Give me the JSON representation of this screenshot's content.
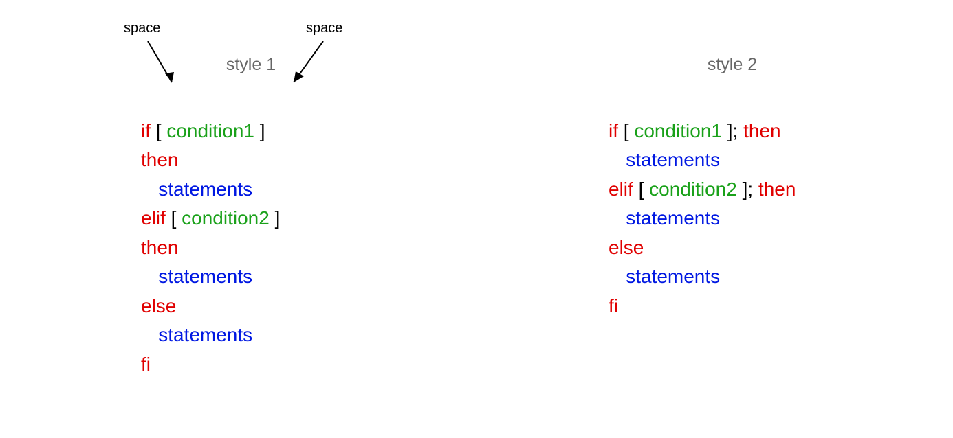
{
  "annotations": {
    "left_label": "space",
    "right_label": "space"
  },
  "style1": {
    "title": "style 1",
    "lines": {
      "l1_if": "if",
      "l1_ob": "[",
      "l1_cond": "condition1",
      "l1_cb": "]",
      "l2_then": "then",
      "l3_stm": "statements",
      "l4_elif": "elif",
      "l4_ob": "[",
      "l4_cond": "condition2",
      "l4_cb": "]",
      "l5_then": "then",
      "l6_stm": "statements",
      "l7_else": "else",
      "l8_stm": "statements",
      "l9_fi": "fi"
    }
  },
  "style2": {
    "title": "style 2",
    "lines": {
      "l1_if": "if",
      "l1_ob": "[",
      "l1_cond": "condition1",
      "l1_cb": "];",
      "l1_then": "then",
      "l2_stm": "statements",
      "l3_elif": "elif",
      "l3_ob": "[",
      "l3_cond": "condition2",
      "l3_cb": "];",
      "l3_then": "then",
      "l4_stm": "statements",
      "l5_else": "else",
      "l6_stm": "statements",
      "l7_fi": "fi"
    }
  }
}
